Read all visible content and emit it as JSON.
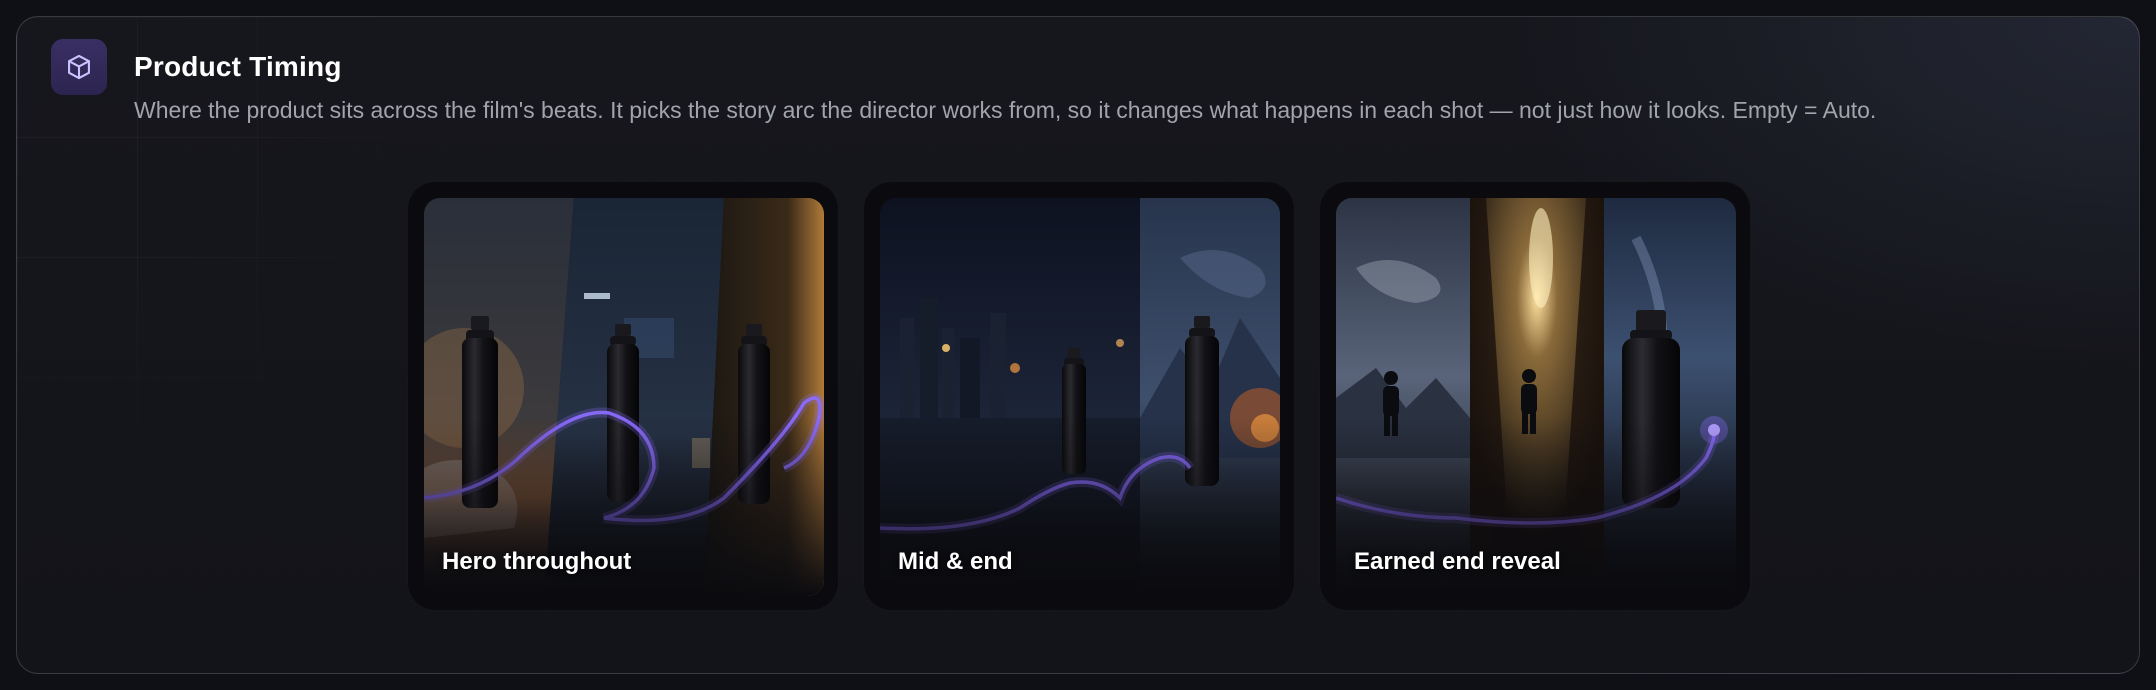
{
  "section": {
    "icon": "cube-icon",
    "title": "Product Timing",
    "description": "Where the product sits across the film's beats. It picks the story arc the director works from, so it changes what happens in each shot — not just how it looks. Empty = Auto."
  },
  "options": [
    {
      "label": "Hero throughout"
    },
    {
      "label": "Mid & end"
    },
    {
      "label": "Earned end reveal"
    }
  ],
  "colors": {
    "accent": "#7c5cff",
    "icon_bg": "#342a5c",
    "panel_border": "#2a2b31"
  }
}
